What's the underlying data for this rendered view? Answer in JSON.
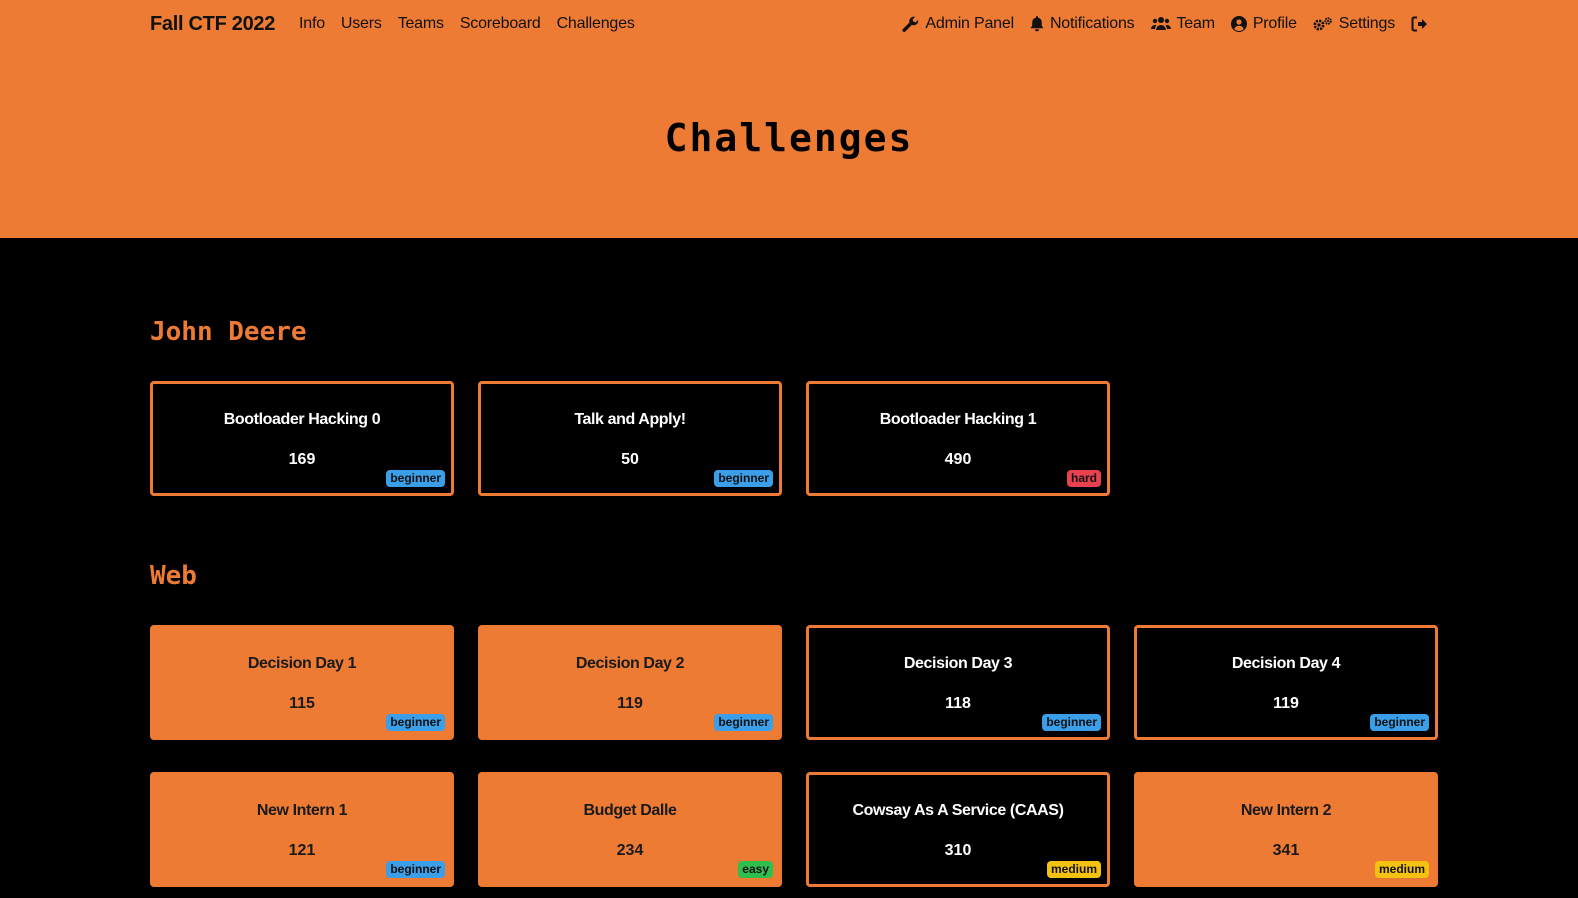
{
  "navbar": {
    "brand": "Fall CTF 2022",
    "left_links": [
      {
        "label": "Info"
      },
      {
        "label": "Users"
      },
      {
        "label": "Teams"
      },
      {
        "label": "Scoreboard"
      },
      {
        "label": "Challenges"
      }
    ],
    "right_links": [
      {
        "label": "Admin Panel",
        "icon": "wrench-icon"
      },
      {
        "label": "Notifications",
        "icon": "bell-icon"
      },
      {
        "label": "Team",
        "icon": "users-icon"
      },
      {
        "label": "Profile",
        "icon": "user-circle-icon"
      },
      {
        "label": "Settings",
        "icon": "gears-icon"
      },
      {
        "label": "",
        "icon": "logout-icon"
      }
    ]
  },
  "page": {
    "title": "Challenges"
  },
  "categories": [
    {
      "name": "John Deere",
      "challenges": [
        {
          "name": "Bootloader Hacking 0",
          "value": "169",
          "difficulty": "beginner",
          "solved": false
        },
        {
          "name": "Talk and Apply!",
          "value": "50",
          "difficulty": "beginner",
          "solved": false
        },
        {
          "name": "Bootloader Hacking 1",
          "value": "490",
          "difficulty": "hard",
          "solved": false
        }
      ]
    },
    {
      "name": "Web",
      "challenges": [
        {
          "name": "Decision Day 1",
          "value": "115",
          "difficulty": "beginner",
          "solved": true
        },
        {
          "name": "Decision Day 2",
          "value": "119",
          "difficulty": "beginner",
          "solved": true
        },
        {
          "name": "Decision Day 3",
          "value": "118",
          "difficulty": "beginner",
          "solved": false
        },
        {
          "name": "Decision Day 4",
          "value": "119",
          "difficulty": "beginner",
          "solved": false
        },
        {
          "name": "New Intern 1",
          "value": "121",
          "difficulty": "beginner",
          "solved": true
        },
        {
          "name": "Budget Dalle",
          "value": "234",
          "difficulty": "easy",
          "solved": true
        },
        {
          "name": "Cowsay As A Service (CAAS)",
          "value": "310",
          "difficulty": "medium",
          "solved": false
        },
        {
          "name": "New Intern 2",
          "value": "341",
          "difficulty": "medium",
          "solved": true
        }
      ]
    }
  ],
  "colors": {
    "accent": "#ee7b33",
    "background": "#000000",
    "beginner": "#3a9ee8",
    "easy": "#2fbf4f",
    "medium": "#f5c211",
    "hard": "#e8414f"
  }
}
